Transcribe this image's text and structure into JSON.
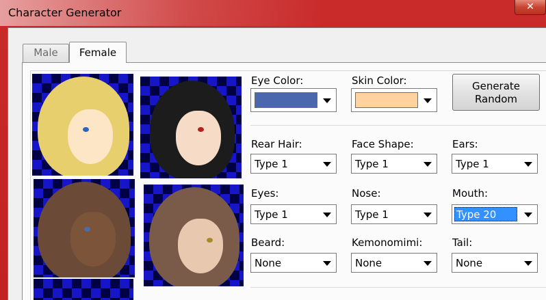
{
  "window": {
    "title": "Character Generator",
    "close_label": "✕"
  },
  "tabs": [
    {
      "label": "Male",
      "selected": false
    },
    {
      "label": "Female",
      "selected": true
    }
  ],
  "portraits": [
    {
      "hair_color": "#e8cf6e",
      "skin_color": "#fde6c6",
      "eye_color": "#2a63c9"
    },
    {
      "hair_color": "#1c1c1c",
      "skin_color": "#f6dcc6",
      "eye_color": "#b8201c"
    },
    {
      "hair_color": "#6b4a38",
      "skin_color": "#7b543a",
      "eye_color": "#4a6fa8"
    },
    {
      "hair_color": "#7a5a48",
      "skin_color": "#e8c8ae",
      "eye_color": "#a88a2c"
    }
  ],
  "fields": {
    "eye_color": {
      "label": "Eye Color:",
      "value_color": "#4b67ad"
    },
    "skin_color": {
      "label": "Skin Color:",
      "value_color": "#ffd2a0"
    },
    "rear_hair": {
      "label": "Rear Hair:",
      "value": "Type 1"
    },
    "face_shape": {
      "label": "Face Shape:",
      "value": "Type 1"
    },
    "ears": {
      "label": "Ears:",
      "value": "Type 1"
    },
    "eyes": {
      "label": "Eyes:",
      "value": "Type 1"
    },
    "nose": {
      "label": "Nose:",
      "value": "Type 1"
    },
    "mouth": {
      "label": "Mouth:",
      "value": "Type 20"
    },
    "beard": {
      "label": "Beard:",
      "value": "None"
    },
    "kemonomimi": {
      "label": "Kemonomimi:",
      "value": "None"
    },
    "tail": {
      "label": "Tail:",
      "value": "None"
    }
  },
  "generate_button": {
    "line1": "Generate",
    "line2": "Random"
  }
}
